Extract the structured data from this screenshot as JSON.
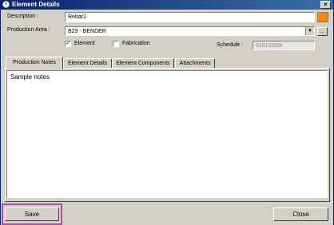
{
  "window": {
    "title": "Element Details"
  },
  "form": {
    "description_label": "Description :",
    "description_value": "Rebar1",
    "production_area_label": "Production Area :",
    "production_area_value": "B29 - BENDER",
    "browse_label": "...",
    "element_checkbox_label": "Element",
    "element_checked": true,
    "fabrication_checkbox_label": "Fabrication",
    "fabrication_checked": false,
    "schedule_label": "Schedule :",
    "schedule_value": "0181/0088",
    "color_swatch": "#f28a0e"
  },
  "tabs": [
    {
      "label": "Production Notes",
      "active": true
    },
    {
      "label": "Element Details",
      "active": false
    },
    {
      "label": "Element Components",
      "active": false
    },
    {
      "label": "Attachments",
      "active": false
    }
  ],
  "notes": {
    "text": "Sample notes"
  },
  "buttons": {
    "save": "Save",
    "close": "Close"
  }
}
